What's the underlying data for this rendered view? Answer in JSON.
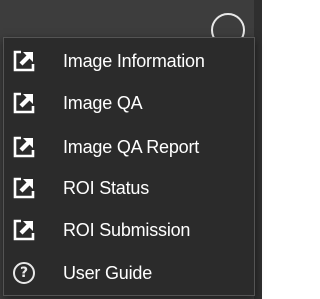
{
  "menu": {
    "items": [
      {
        "label": "Image Information",
        "icon": "external-link-icon"
      },
      {
        "label": "Image QA",
        "icon": "external-link-icon"
      },
      {
        "label": "Image QA Report",
        "icon": "external-link-icon"
      },
      {
        "label": "ROI Status",
        "icon": "external-link-icon"
      },
      {
        "label": "ROI Submission",
        "icon": "external-link-icon"
      },
      {
        "label": "User Guide",
        "icon": "help-icon"
      }
    ],
    "help_glyph": "?"
  },
  "more_button": {
    "icon": "more-options-icon"
  },
  "colors": {
    "menu_background": "#2b2b2b",
    "text": "#ffffff",
    "icon": "#ffffff"
  }
}
